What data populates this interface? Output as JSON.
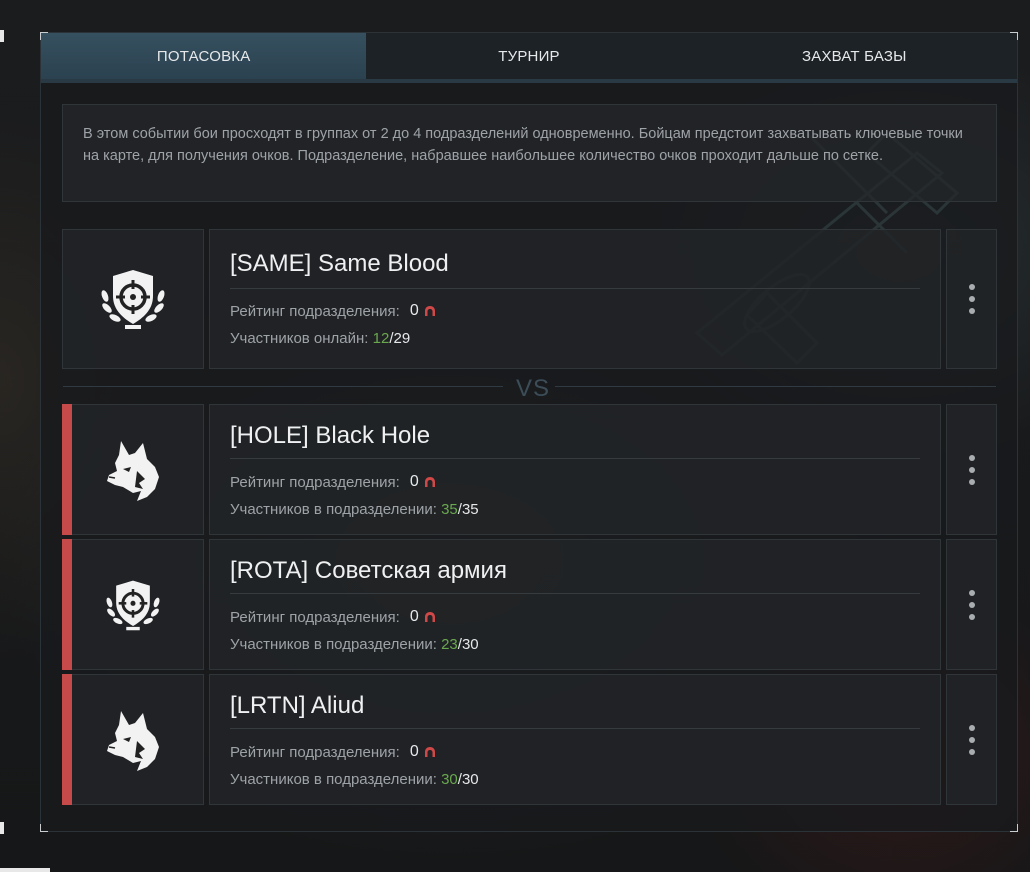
{
  "tabs": [
    {
      "label": "ПОТАСОВКА",
      "active": true
    },
    {
      "label": "ТУРНИР",
      "active": false
    },
    {
      "label": "ЗАХВАТ БАЗЫ",
      "active": false
    }
  ],
  "description": "В этом событии бои просходят в группах от 2 до 4 подразделений одновременно. Бойцам предстоит захватывать ключевые точки на карте, для получения очков. Подразделение, набравшее наибольшее количество очков проходит дальше по сетке.",
  "vs_label": "VS",
  "own_unit": {
    "name": "[SAME] Same Blood",
    "emblem": "crosshair-shield-icon",
    "rating_label": "Рейтинг подразделения:",
    "rating_value": "0",
    "members_label": "Участников онлайн:",
    "members_current": "12",
    "members_max": "29"
  },
  "opponents": [
    {
      "name": "[HOLE] Black Hole",
      "emblem": "wolf-head-icon",
      "rating_label": "Рейтинг подразделения:",
      "rating_value": "0",
      "members_label": "Участников в подразделении:",
      "members_current": "35",
      "members_max": "35"
    },
    {
      "name": "[ROTA] Советская армия",
      "emblem": "crosshair-shield-icon",
      "rating_label": "Рейтинг подразделения:",
      "rating_value": "0",
      "members_label": "Участников в подразделении:",
      "members_current": "23",
      "members_max": "30"
    },
    {
      "name": "[LRTN] Aliud",
      "emblem": "wolf-head-icon",
      "rating_label": "Рейтинг подразделения:",
      "rating_value": "0",
      "members_label": "Участников в подразделении:",
      "members_current": "30",
      "members_max": "30"
    }
  ],
  "colors": {
    "accent_red": "#c64a4a",
    "online_green": "#6aa84f",
    "active_tab": "#36505f"
  }
}
